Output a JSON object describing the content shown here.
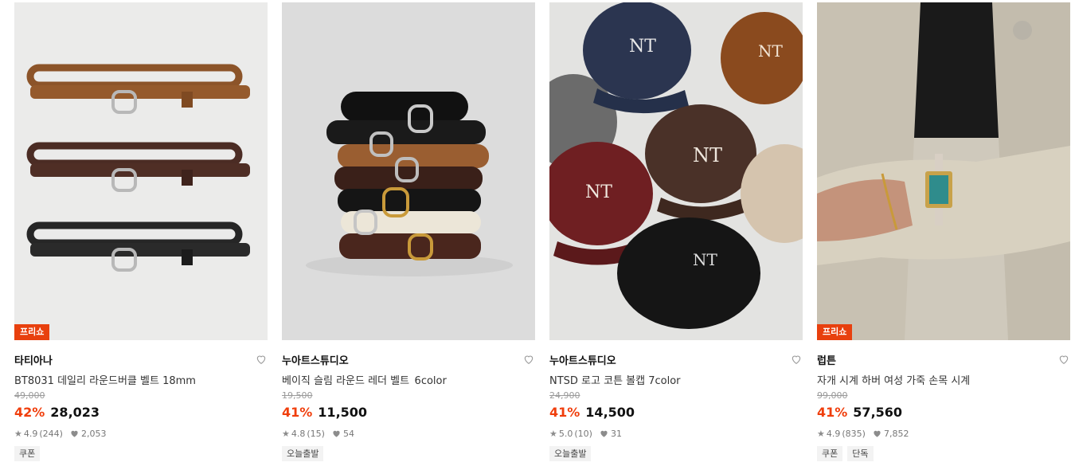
{
  "products": [
    {
      "badge": "프리쇼",
      "brand": "타티아나",
      "title": "BT8031 데일리 라운드버클 벨트 18mm",
      "original_price": "49,000",
      "discount": "42%",
      "price": "28,023",
      "rating": "4.9",
      "review_count": "(244)",
      "likes": "2,053",
      "tags": [
        "쿠폰"
      ],
      "image": "belt-trio-brown-darkbrown-black"
    },
    {
      "badge": "",
      "brand": "누아트스튜디오",
      "title": "베이직 슬림 라운드 레더 벨트_6color",
      "original_price": "19,500",
      "discount": "41%",
      "price": "11,500",
      "rating": "4.8",
      "review_count": "(15)",
      "likes": "54",
      "tags": [
        "오늘출발"
      ],
      "image": "stacked-belts-six-colors"
    },
    {
      "badge": "",
      "brand": "누아트스튜디오",
      "title": "NTSD 로고 코튼 볼캡 7color",
      "original_price": "24,900",
      "discount": "41%",
      "price": "14,500",
      "rating": "5.0",
      "review_count": "(10)",
      "likes": "31",
      "tags": [
        "오늘출발"
      ],
      "image": "ball-caps-seven-colors"
    },
    {
      "badge": "프리쇼",
      "brand": "럽튼",
      "title": "자개 시계 하버 여성 가죽 손목 시계",
      "original_price": "99,000",
      "discount": "41%",
      "price": "57,560",
      "rating": "4.9",
      "review_count": "(835)",
      "likes": "7,852",
      "tags": [
        "쿠폰",
        "단독"
      ],
      "image": "wrist-watch-on-tweed-sleeve"
    }
  ],
  "icons": {
    "like": "heart-outline-icon",
    "rating": "star-icon",
    "likes_count": "heart-filled-icon"
  },
  "colors": {
    "discount": "#f03e0c",
    "badge": "#e8400e"
  }
}
